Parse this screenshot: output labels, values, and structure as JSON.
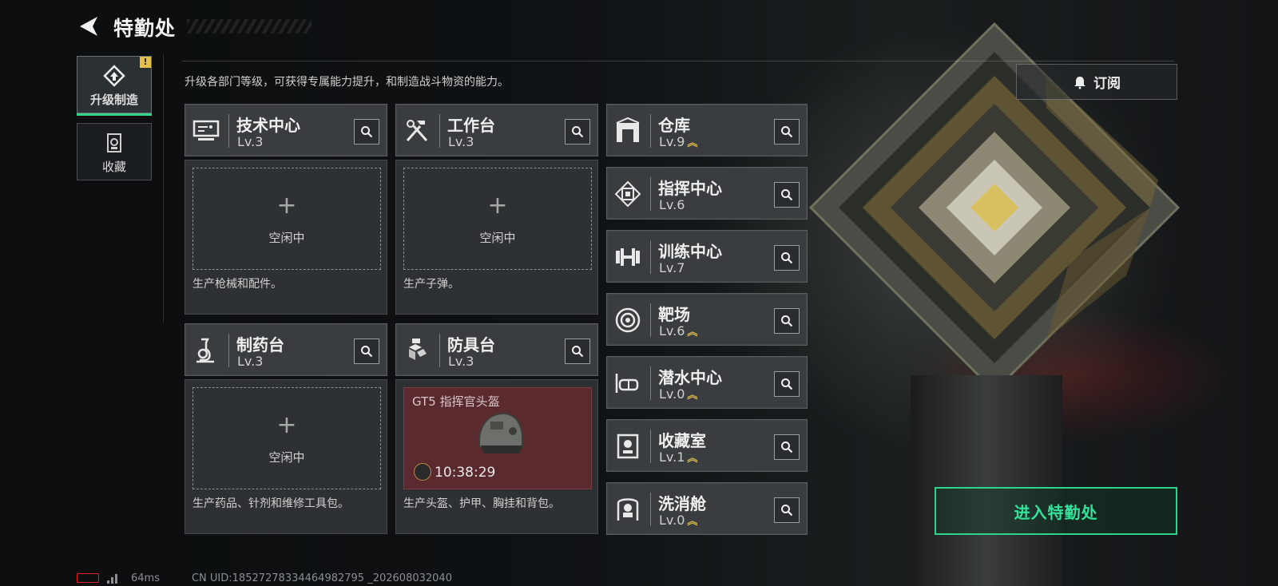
{
  "header": {
    "title": "特勤处"
  },
  "side_tabs": [
    {
      "label": "升级制造",
      "icon": "upgrade-build-icon",
      "active": true,
      "badge": "!"
    },
    {
      "label": "收藏",
      "icon": "collection-icon",
      "active": false
    }
  ],
  "description": "升级各部门等级，可获得专属能力提升，和制造战斗物资的能力。",
  "subscribe_label": "订阅",
  "production_cards": [
    {
      "name": "技术中心",
      "level": "Lv.3",
      "icon": "tech-center-icon",
      "slot_status": "空闲中",
      "desc": "生产枪械和配件。"
    },
    {
      "name": "工作台",
      "level": "Lv.3",
      "icon": "workbench-icon",
      "slot_status": "空闲中",
      "desc": "生产子弹。"
    },
    {
      "name": "制药台",
      "level": "Lv.3",
      "icon": "pharmacy-icon",
      "slot_status": "空闲中",
      "desc": "生产药品、针剂和维修工具包。"
    },
    {
      "name": "防具台",
      "level": "Lv.3",
      "icon": "armor-bench-icon",
      "craft_item": "GT5 指挥官头盔",
      "craft_timer": "10:38:29",
      "desc": "生产头盔、护甲、胸挂和背包。"
    }
  ],
  "departments": [
    {
      "name": "仓库",
      "level": "Lv.9",
      "upgradable": true,
      "icon": "warehouse-icon"
    },
    {
      "name": "指挥中心",
      "level": "Lv.6",
      "upgradable": false,
      "icon": "command-center-icon"
    },
    {
      "name": "训练中心",
      "level": "Lv.7",
      "upgradable": false,
      "icon": "training-center-icon"
    },
    {
      "name": "靶场",
      "level": "Lv.6",
      "upgradable": true,
      "icon": "shooting-range-icon"
    },
    {
      "name": "潜水中心",
      "level": "Lv.0",
      "upgradable": true,
      "icon": "diving-center-icon"
    },
    {
      "name": "收藏室",
      "level": "Lv.1",
      "upgradable": true,
      "icon": "collection-room-icon"
    },
    {
      "name": "洗消舱",
      "level": "Lv.0",
      "upgradable": true,
      "icon": "decontamination-icon"
    }
  ],
  "enter_button": "进入特勤处",
  "status_bar": {
    "ping": "64ms",
    "uid": "CN UID:18527278334464982795 _202608032040"
  },
  "colors": {
    "accent_green": "#33e39a",
    "upgrade_gold": "#d8b44c",
    "craft_red": "#5a2a2e"
  }
}
